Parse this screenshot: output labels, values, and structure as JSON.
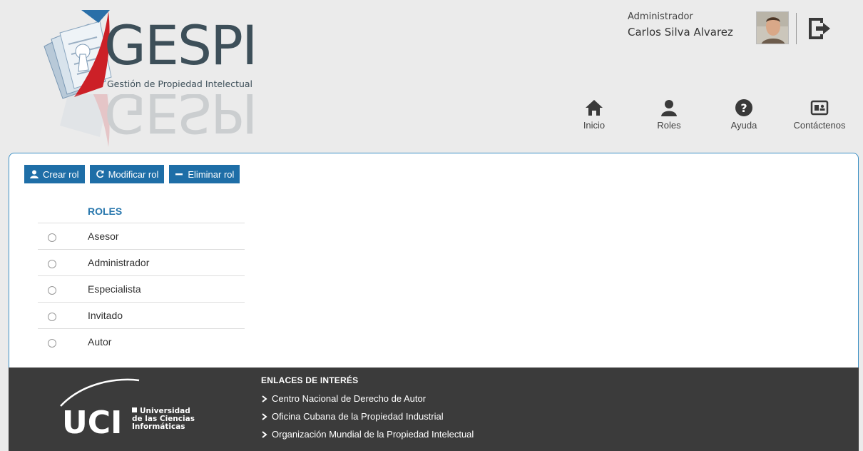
{
  "brand": {
    "name": "GESPI",
    "tagline": "Gestión de Propiedad Intelectual",
    "accent": "#3d4f59",
    "red": "#cc2027",
    "blue": "#2a6fa8"
  },
  "user": {
    "role": "Administrador",
    "name": "Carlos Silva Alvarez"
  },
  "nav": [
    {
      "label": "Inicio",
      "icon": "home-icon"
    },
    {
      "label": "Roles",
      "icon": "user-icon"
    },
    {
      "label": "Ayuda",
      "icon": "help-icon"
    },
    {
      "label": "Contáctenos",
      "icon": "contact-card-icon"
    }
  ],
  "toolbar": {
    "create_label": "Crear rol",
    "modify_label": "Modificar rol",
    "delete_label": "Eliminar rol"
  },
  "roles": {
    "header": "ROLES",
    "items": [
      "Asesor",
      "Administrador",
      "Especialista",
      "Invitado",
      "Autor"
    ]
  },
  "footer": {
    "university_line1": "Universidad",
    "university_line2": "de las Ciencias",
    "university_line3": "Informáticas",
    "links_title": "ENLACES DE INTERÉS",
    "links": [
      "Centro Nacional de Derecho de Autor",
      "Oficina Cubana de la Propiedad Industrial",
      "Organización Mundial de la Propiedad Intelectual"
    ]
  }
}
